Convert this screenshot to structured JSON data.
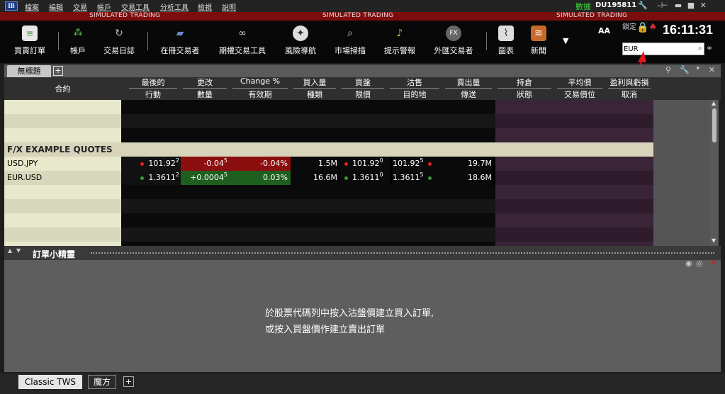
{
  "menu": {
    "logo": "IB",
    "items": [
      "檔案",
      "編輯",
      "交易",
      "帳戶",
      "交易工具",
      "分析工具",
      "檢視",
      "說明"
    ],
    "data_status": "數據",
    "account_id": "DU195811"
  },
  "sim_banner": [
    "SIMULATED TRADING",
    "SIMULATED TRADING",
    "SIMULATED TRADING"
  ],
  "toolbar": {
    "buttons": [
      {
        "label": "買賣訂單",
        "icon": "order-sheet-icon"
      },
      {
        "label": "帳戶",
        "icon": "account-icon"
      },
      {
        "label": "交易日誌",
        "icon": "trade-log-icon"
      },
      {
        "label": "在冊交易者",
        "icon": "book-trader-icon"
      },
      {
        "label": "期權交易工具",
        "icon": "option-trader-icon"
      },
      {
        "label": "風險導航",
        "icon": "compass-icon"
      },
      {
        "label": "市場掃描",
        "icon": "scanner-icon"
      },
      {
        "label": "提示警報",
        "icon": "alert-bell-icon"
      },
      {
        "label": "外匯交易者",
        "icon": "fx-trader-icon"
      },
      {
        "label": "圖表",
        "icon": "chart-icon"
      },
      {
        "label": "新聞",
        "icon": "news-icon"
      }
    ],
    "font_size_toggle": "AA",
    "lock_label": "鎖定",
    "clock": "16:11:31",
    "symbol_value": "EUR"
  },
  "page_tabs": {
    "active": "無標題",
    "add": "+"
  },
  "columns": [
    {
      "top": "合約",
      "bottom": ""
    },
    {
      "top": "最後的",
      "bottom": "行動"
    },
    {
      "top": "更改",
      "bottom": "數量"
    },
    {
      "top": "Change %",
      "bottom": "有效期"
    },
    {
      "top": "買入量",
      "bottom": "種類"
    },
    {
      "top": "買盤",
      "bottom": "限價"
    },
    {
      "top": "沽售",
      "bottom": "目的地"
    },
    {
      "top": "賣出量",
      "bottom": "傳送"
    },
    {
      "top": "持倉",
      "bottom": "狀態"
    },
    {
      "top": "平均價",
      "bottom": "交易價位"
    },
    {
      "top": "盈利與虧損",
      "bottom": "取消"
    }
  ],
  "group_title": "F/X EXAMPLE QUOTES",
  "quotes": [
    {
      "symbol": "USD.JPY",
      "last": "101.92",
      "last_sub": "2",
      "last_dot": "#e02020",
      "change": "-0.04",
      "change_sub": "5",
      "change_pct": "-0.04%",
      "bid_size": "1.5M",
      "bid": "101.92",
      "bid_sub": "0",
      "ask": "101.92",
      "ask_sub": "5",
      "ask_dot": "#e02020",
      "ask_size": "19.7M",
      "change_bg": "#8b0f0f",
      "bid_dot": "#e02020"
    },
    {
      "symbol": "EUR.USD",
      "last": "1.3611",
      "last_sub": "2",
      "last_dot": "#3a9a3a",
      "change": "+0.0004",
      "change_sub": "5",
      "change_pct": "0.03%",
      "bid_size": "16.6M",
      "bid": "1.3611",
      "bid_sub": "0",
      "ask": "1.3611",
      "ask_sub": "5",
      "ask_dot": "#3a9a3a",
      "ask_size": "18.6M",
      "change_bg": "#1e5e1e",
      "bid_dot": "#3a9a3a"
    }
  ],
  "order_wizard": {
    "title": "訂單小精靈",
    "message_line1": "於股票代碼列中按入沽盤價建立買入訂單,",
    "message_line2": "或按入買盤價作建立賣出訂單"
  },
  "bottom_tabs": [
    "Classic TWS",
    "魔方",
    "+"
  ]
}
